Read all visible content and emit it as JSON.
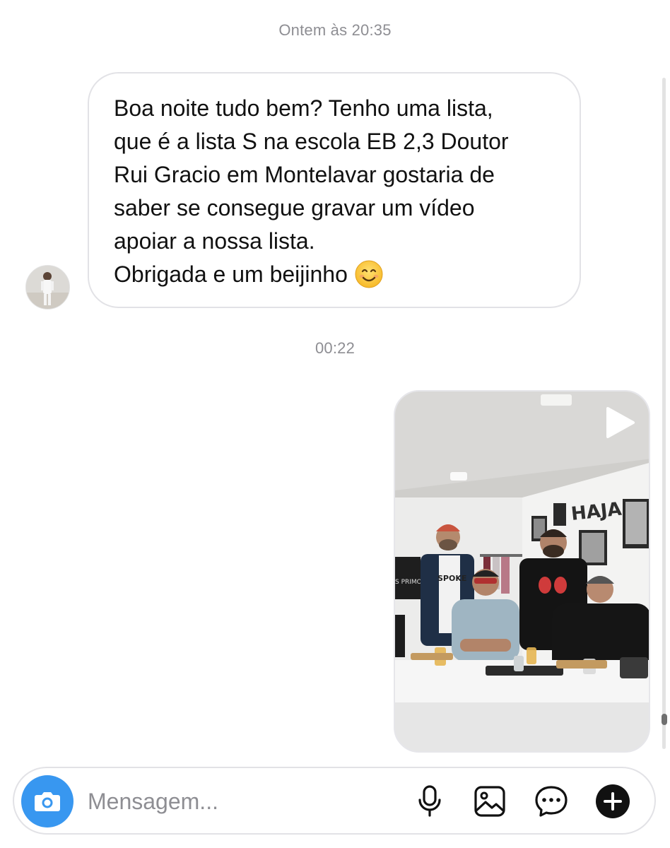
{
  "thread": {
    "timestamps": [
      "Ontem às 20:35",
      "00:22"
    ],
    "incoming_message": {
      "lines": [
        "Boa noite tudo bem? Tenho uma lista,",
        "que é a lista S na escola EB 2,3 Doutor",
        "Rui Gracio em Montelavar gostaria de",
        "saber se consegue gravar um vídeo",
        "apoiar a nossa lista.",
        "Obrigada e um beijinho"
      ],
      "emoji": "smiling-face-emoji"
    },
    "outgoing_video": {
      "icon": "play-icon",
      "scene_text": {
        "wall_logo": "HAJA",
        "shirt_text": "SPOKE",
        "poster_text": "S PRIMOS"
      }
    }
  },
  "composer": {
    "placeholder": "Mensagem...",
    "camera_icon": "camera-icon",
    "tools": [
      "microphone-icon",
      "gallery-icon",
      "sticker-icon",
      "plus-icon"
    ],
    "accent_color": "#3897f0"
  }
}
